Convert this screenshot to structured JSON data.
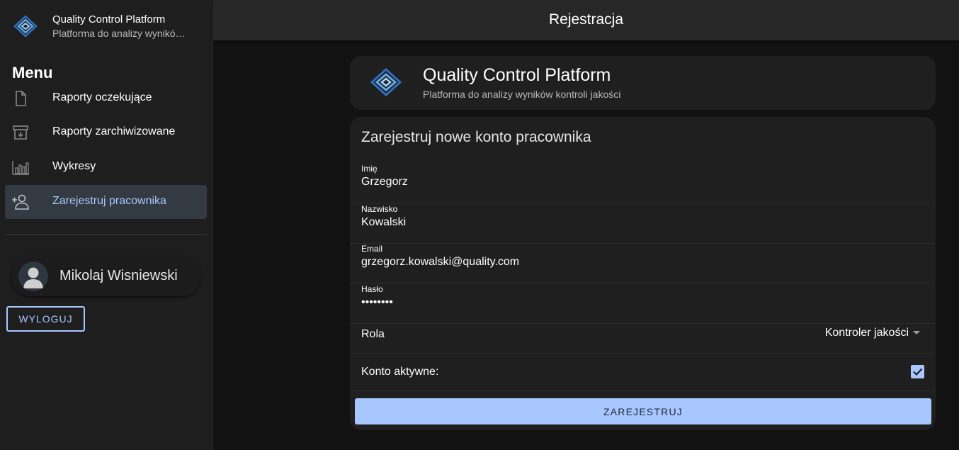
{
  "app": {
    "title": "Quality Control Platform",
    "subtitle_truncated": "Platforma do analizy wynikó…"
  },
  "topbar": {
    "title": "Rejestracja"
  },
  "sidebar": {
    "menu_heading": "Menu",
    "items": [
      {
        "label": "Raporty oczekujące",
        "icon": "document-icon",
        "active": false
      },
      {
        "label": "Raporty zarchiwizowane",
        "icon": "archive-icon",
        "active": false
      },
      {
        "label": "Wykresy",
        "icon": "bar-chart-icon",
        "active": false
      },
      {
        "label": "Zarejestruj pracownika",
        "icon": "add-user-icon",
        "active": true
      }
    ],
    "user_name": "Mikolaj Wisniewski",
    "logout_label": "WYLOGUJ"
  },
  "header_card": {
    "title": "Quality Control Platform",
    "subtitle": "Platforma do analizy wyników kontroli jakości"
  },
  "form": {
    "title": "Zarejestruj nowe konto pracownika",
    "fields": {
      "first_name": {
        "label": "Imię",
        "value": "Grzegorz"
      },
      "last_name": {
        "label": "Nazwisko",
        "value": "Kowalski"
      },
      "email": {
        "label": "Email",
        "value": "grzegorz.kowalski@quality.com"
      },
      "password": {
        "label": "Hasło",
        "value": "password"
      }
    },
    "role": {
      "label": "Rola",
      "selected": "Kontroler jakości"
    },
    "active": {
      "label": "Konto aktywne:",
      "checked": true
    },
    "submit_label": "ZAREJESTRUJ"
  },
  "colors": {
    "accent": "#a9c7ff",
    "background": "#121212",
    "surface": "#1f1f1f",
    "sidebar": "#1e1e1e",
    "topbar": "#272727",
    "active_nav": "#343a42"
  }
}
